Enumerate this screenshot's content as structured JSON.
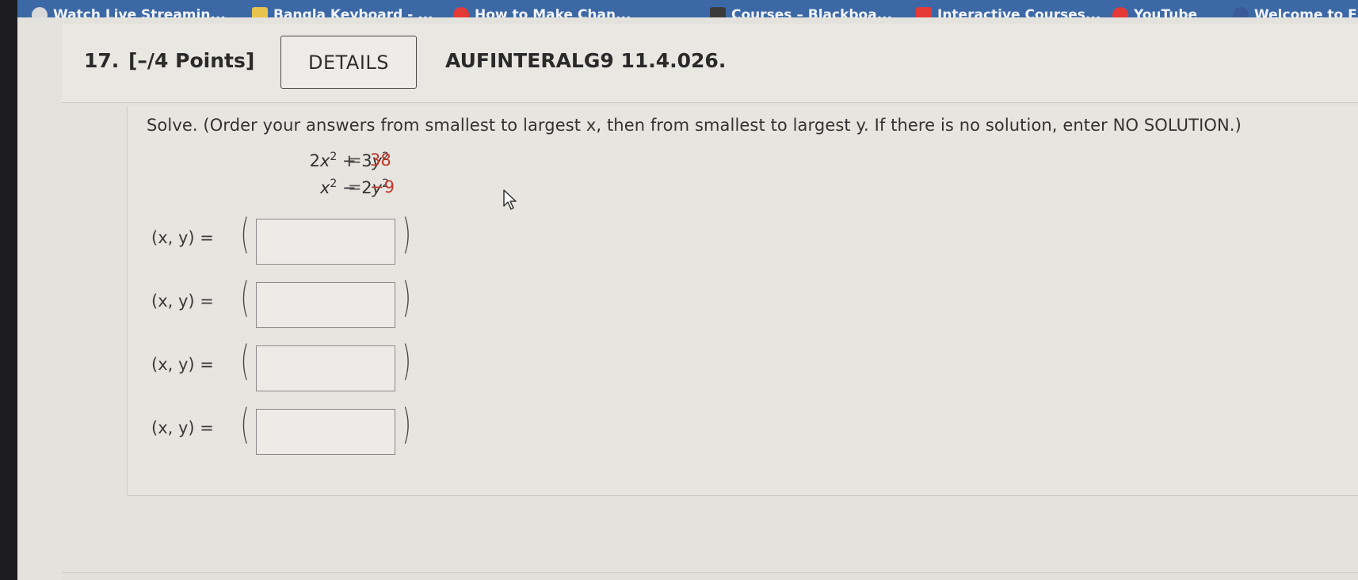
{
  "browser": {
    "bookmarks": [
      {
        "label": "Watch Live Streamin...",
        "icon": "play-icon",
        "color": "#d9d9d9"
      },
      {
        "label": "Bangla Keyboard - ...",
        "icon": "image-icon",
        "color": "#e6c34a"
      },
      {
        "label": "How to Make Chan...",
        "icon": "youtube-icon",
        "color": "#e53935"
      },
      {
        "label": "Courses – Blackboa...",
        "icon": "blackboard-icon",
        "color": "#3a3a3a"
      },
      {
        "label": "Interactive Courses...",
        "icon": "courses-icon",
        "color": "#e53935"
      },
      {
        "label": "YouTube",
        "icon": "youtube-icon",
        "color": "#e53935"
      },
      {
        "label": "Welcome to F",
        "icon": "facebook-icon",
        "color": "#3b5998"
      }
    ]
  },
  "question": {
    "number": "17.",
    "points": "[–/4 Points]",
    "details_label": "DETAILS",
    "code": "AUFINTERALG9 11.4.026."
  },
  "body": {
    "instructions": "Solve. (Order your answers from smallest to largest x, then from smallest to largest y. If there is no solution, enter NO SOLUTION.)",
    "equations": [
      {
        "rhs": "38"
      },
      {
        "rhs": "−9"
      }
    ],
    "answer_label": "(x, y) =",
    "answers": [
      {
        "value": ""
      },
      {
        "value": ""
      },
      {
        "value": ""
      },
      {
        "value": ""
      }
    ]
  }
}
